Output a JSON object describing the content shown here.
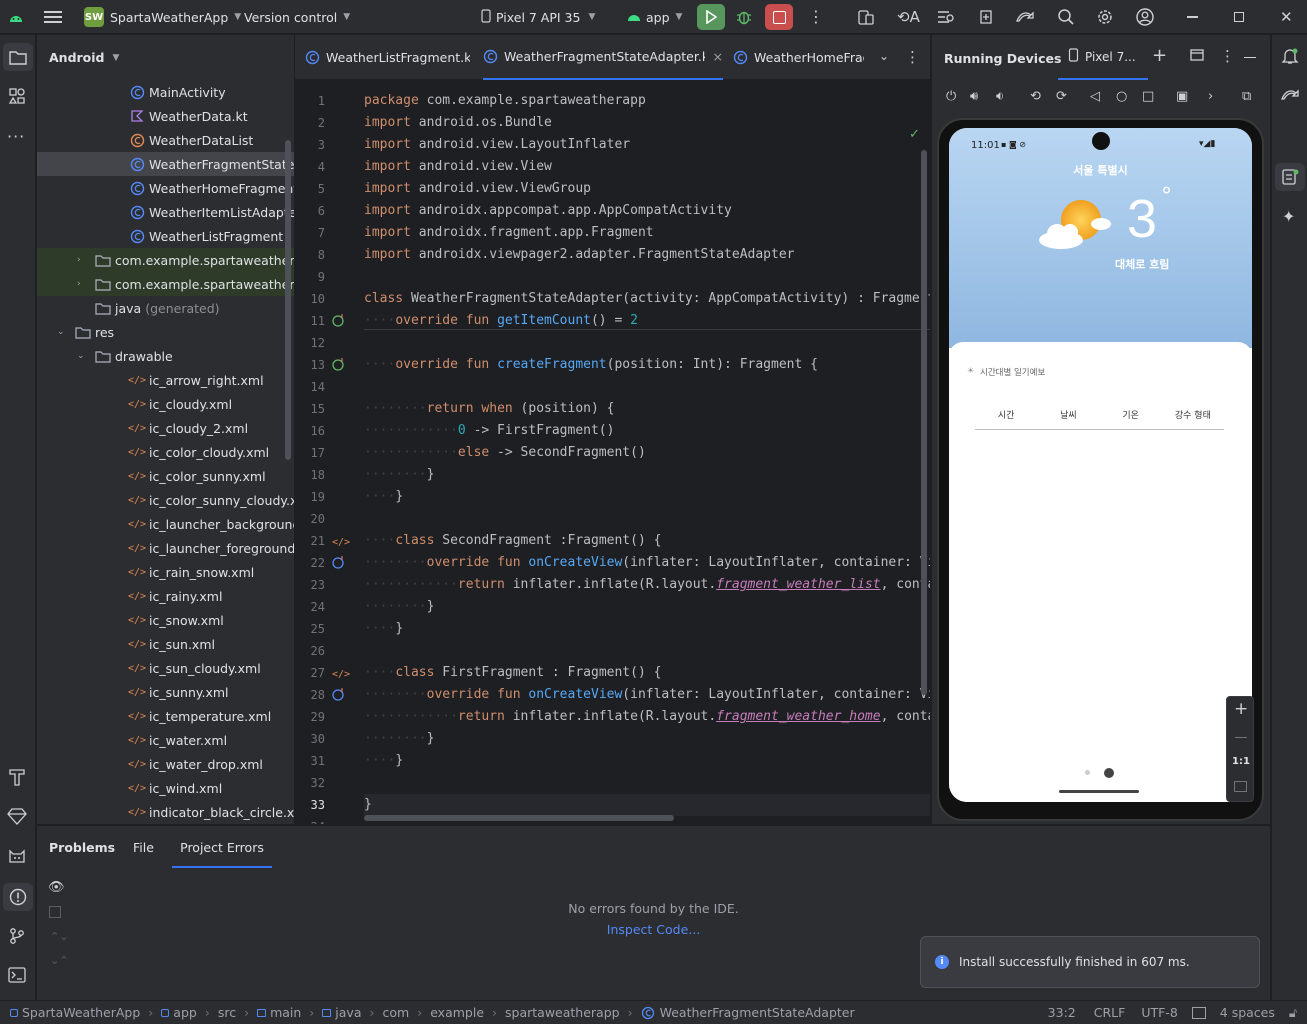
{
  "titlebar": {
    "project_badge": "SW",
    "project_name": "SpartaWeatherApp",
    "vcs": "Version control",
    "device": "Pixel 7 API 35",
    "run_config": "app"
  },
  "project_panel": {
    "title": "Android",
    "rows": [
      {
        "label": "MainActivity",
        "indent": 3,
        "icon": "kotlin-class-icon"
      },
      {
        "label": "WeatherData.kt",
        "indent": 3,
        "icon": "kotlin-file-icon"
      },
      {
        "label": "WeatherDataList",
        "indent": 3,
        "icon": "kotlin-object-icon"
      },
      {
        "label": "WeatherFragmentStateAdapter",
        "indent": 3,
        "icon": "kotlin-class-icon",
        "selected": true
      },
      {
        "label": "WeatherHomeFragment",
        "indent": 3,
        "icon": "kotlin-class-icon"
      },
      {
        "label": "WeatherItemListAdapter",
        "indent": 3,
        "icon": "kotlin-class-icon"
      },
      {
        "label": "WeatherListFragment",
        "indent": 3,
        "icon": "kotlin-class-icon"
      },
      {
        "label": "com.example.spartaweatherapp (androidTest)",
        "indent": 2,
        "icon": "package-icon",
        "collapsed": true,
        "highlight": true
      },
      {
        "label": "com.example.spartaweatherapp (test)",
        "indent": 2,
        "icon": "package-icon",
        "collapsed": true,
        "highlight": true
      },
      {
        "label": "java",
        "suffix": "(generated)",
        "indent": 2,
        "icon": "folder-icon"
      },
      {
        "label": "res",
        "indent": 1,
        "icon": "folder-icon",
        "expanded": true
      },
      {
        "label": "drawable",
        "indent": 2,
        "icon": "folder-icon",
        "expanded": true
      },
      {
        "label": "ic_arrow_right.xml",
        "indent": 3,
        "icon": "xml-icon"
      },
      {
        "label": "ic_cloudy.xml",
        "indent": 3,
        "icon": "xml-icon"
      },
      {
        "label": "ic_cloudy_2.xml",
        "indent": 3,
        "icon": "xml-icon"
      },
      {
        "label": "ic_color_cloudy.xml",
        "indent": 3,
        "icon": "xml-icon"
      },
      {
        "label": "ic_color_sunny.xml",
        "indent": 3,
        "icon": "xml-icon"
      },
      {
        "label": "ic_color_sunny_cloudy.xml",
        "indent": 3,
        "icon": "xml-icon"
      },
      {
        "label": "ic_launcher_background.xml",
        "indent": 3,
        "icon": "xml-icon"
      },
      {
        "label": "ic_launcher_foreground.xml",
        "indent": 3,
        "icon": "xml-icon"
      },
      {
        "label": "ic_rain_snow.xml",
        "indent": 3,
        "icon": "xml-icon"
      },
      {
        "label": "ic_rainy.xml",
        "indent": 3,
        "icon": "xml-icon"
      },
      {
        "label": "ic_snow.xml",
        "indent": 3,
        "icon": "xml-icon"
      },
      {
        "label": "ic_sun.xml",
        "indent": 3,
        "icon": "xml-icon"
      },
      {
        "label": "ic_sun_cloudy.xml",
        "indent": 3,
        "icon": "xml-icon"
      },
      {
        "label": "ic_sunny.xml",
        "indent": 3,
        "icon": "xml-icon"
      },
      {
        "label": "ic_temperature.xml",
        "indent": 3,
        "icon": "xml-icon"
      },
      {
        "label": "ic_water.xml",
        "indent": 3,
        "icon": "xml-icon"
      },
      {
        "label": "ic_water_drop.xml",
        "indent": 3,
        "icon": "xml-icon"
      },
      {
        "label": "ic_wind.xml",
        "indent": 3,
        "icon": "xml-icon"
      },
      {
        "label": "indicator_black_circle.xml",
        "indent": 3,
        "icon": "xml-icon"
      }
    ]
  },
  "editor": {
    "tabs": [
      {
        "label": "WeatherListFragment.kt",
        "active": false
      },
      {
        "label": "WeatherFragmentStateAdapter.kt",
        "active": true,
        "close": "×"
      },
      {
        "label": "WeatherHomeFragment.kt",
        "active": false
      }
    ],
    "lines": [
      [
        [
          "kw",
          "package"
        ],
        [
          "t",
          " com.example.spartaweatherapp"
        ]
      ],
      [
        [
          "kw",
          "import"
        ],
        [
          "t",
          " android.os.Bundle"
        ]
      ],
      [
        [
          "kw",
          "import"
        ],
        [
          "t",
          " android.view.LayoutInflater"
        ]
      ],
      [
        [
          "kw",
          "import"
        ],
        [
          "t",
          " android.view.View"
        ]
      ],
      [
        [
          "kw",
          "import"
        ],
        [
          "t",
          " android.view.ViewGroup"
        ]
      ],
      [
        [
          "kw",
          "import"
        ],
        [
          "t",
          " androidx.appcompat.app.AppCompatActivity"
        ]
      ],
      [
        [
          "kw",
          "import"
        ],
        [
          "t",
          " androidx.fragment.app.Fragment"
        ]
      ],
      [
        [
          "kw",
          "import"
        ],
        [
          "t",
          " androidx.viewpager2.adapter.FragmentStateAdapter"
        ]
      ],
      [],
      [
        [
          "kw",
          "class"
        ],
        [
          "t",
          " WeatherFragmentStateAdapter(activity: AppCompatActivity) : FragmentStateAdapter(activity) {"
        ]
      ],
      [
        [
          "dim",
          "····"
        ],
        [
          "kw",
          "override fun "
        ],
        [
          "fn",
          "getItemCount"
        ],
        [
          "t",
          "() = "
        ],
        [
          "num",
          "2"
        ]
      ],
      [],
      [
        [
          "dim",
          "····"
        ],
        [
          "kw",
          "override fun "
        ],
        [
          "fn",
          "createFragment"
        ],
        [
          "t",
          "(position: Int): Fragment {"
        ]
      ],
      [],
      [
        [
          "dim",
          "········"
        ],
        [
          "kw",
          "return when "
        ],
        [
          "t",
          "(position) {"
        ]
      ],
      [
        [
          "dim",
          "············"
        ],
        [
          "num",
          "0"
        ],
        [
          "t",
          " -> FirstFragment()"
        ]
      ],
      [
        [
          "dim",
          "············"
        ],
        [
          "kw",
          "else"
        ],
        [
          "t",
          " -> SecondFragment()"
        ]
      ],
      [
        [
          "dim",
          "········"
        ],
        [
          "t",
          "}"
        ]
      ],
      [
        [
          "dim",
          "····"
        ],
        [
          "t",
          "}"
        ]
      ],
      [],
      [
        [
          "dim",
          "····"
        ],
        [
          "kw",
          "class "
        ],
        [
          "t",
          "SecondFragment :Fragment() {"
        ]
      ],
      [
        [
          "dim",
          "········"
        ],
        [
          "kw",
          "override fun "
        ],
        [
          "fn",
          "onCreateView"
        ],
        [
          "t",
          "(inflater: LayoutInflater, container: ViewGroup?, savedInstanceState: Bundle?): View? {"
        ]
      ],
      [
        [
          "dim",
          "············"
        ],
        [
          "kw",
          "return "
        ],
        [
          "t",
          "inflater.inflate(R.layout."
        ],
        [
          "it",
          "fragment_weather_list"
        ],
        [
          "t",
          ", container, false)"
        ]
      ],
      [
        [
          "dim",
          "········"
        ],
        [
          "t",
          "}"
        ]
      ],
      [
        [
          "dim",
          "····"
        ],
        [
          "t",
          "}"
        ]
      ],
      [],
      [
        [
          "dim",
          "····"
        ],
        [
          "kw",
          "class "
        ],
        [
          "t",
          "FirstFragment : Fragment() {"
        ]
      ],
      [
        [
          "dim",
          "········"
        ],
        [
          "kw",
          "override fun "
        ],
        [
          "fn",
          "onCreateView"
        ],
        [
          "t",
          "(inflater: LayoutInflater, container: ViewGroup?, savedInstanceState: Bundle?): View? {"
        ]
      ],
      [
        [
          "dim",
          "············"
        ],
        [
          "kw",
          "return "
        ],
        [
          "t",
          "inflater.inflate(R.layout."
        ],
        [
          "it",
          "fragment_weather_home"
        ],
        [
          "t",
          ", container, false)"
        ]
      ],
      [
        [
          "dim",
          "········"
        ],
        [
          "t",
          "}"
        ]
      ],
      [
        [
          "dim",
          "····"
        ],
        [
          "t",
          "}"
        ]
      ],
      [],
      [
        [
          "t",
          "}"
        ]
      ],
      []
    ],
    "gutter_marks": {
      "11": "override",
      "13": "override",
      "21": "html",
      "22": "impl",
      "27": "html",
      "28": "impl"
    }
  },
  "devices": {
    "title": "Running Devices",
    "tab": "Pixel 7...",
    "phone": {
      "time": "11:01",
      "city": "서울 특별시",
      "temp": "3",
      "degree": "°",
      "condition": "대체로 흐림",
      "section_title": "시간대별 일기예보",
      "columns": [
        "시간",
        "날씨",
        "기온",
        "강수 형태"
      ],
      "zoom_label": "1:1"
    }
  },
  "bottom": {
    "tabs": [
      "Problems",
      "File",
      "Project Errors"
    ],
    "active_tab": "Project Errors",
    "empty_text": "No errors found by the IDE.",
    "link": "Inspect Code...",
    "notification": "Install successfully finished in 607 ms."
  },
  "statusbar": {
    "crumbs": [
      "SpartaWeatherApp",
      "app",
      "src",
      "main",
      "java",
      "com",
      "example",
      "spartaweatherapp",
      "WeatherFragmentStateAdapter"
    ],
    "position": "33:2",
    "line_sep": "CRLF",
    "encoding": "UTF-8",
    "indent": "4 spaces"
  },
  "colors": {
    "accent": "#3574f0",
    "run_green": "#57965c",
    "stop_red": "#c94f4f",
    "keyword": "#cf8e6d",
    "function": "#56a8f5",
    "number": "#2aacb8"
  }
}
